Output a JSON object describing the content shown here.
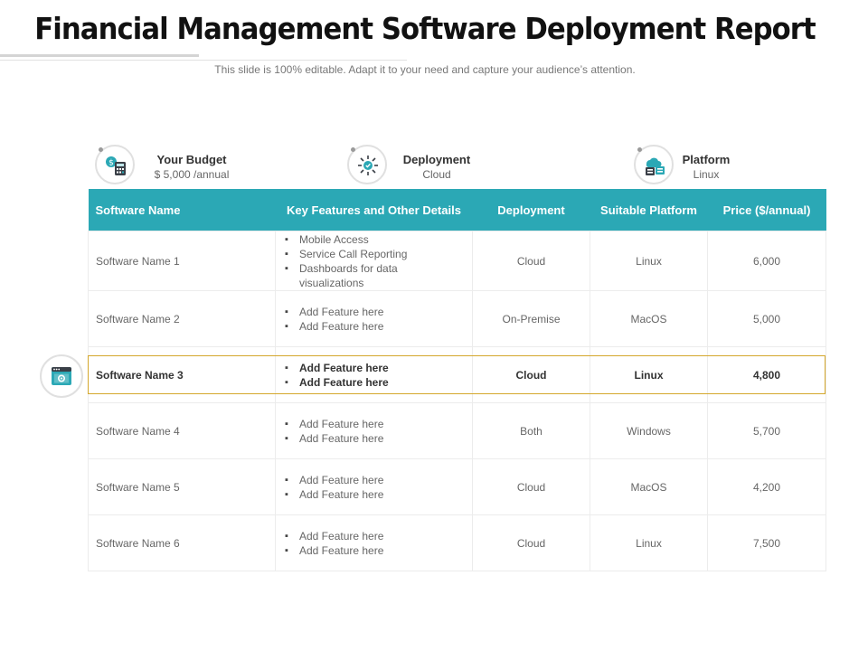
{
  "header": {
    "title": "Financial Management Software Deployment Report",
    "subtitle": "This slide is 100% editable. Adapt it to your need and capture your audience’s attention."
  },
  "info": {
    "budget": {
      "label": "Your Budget",
      "value": "$ 5,000 /annual",
      "icon": "calculator-money-icon"
    },
    "deployment": {
      "label": "Deployment",
      "value": "Cloud",
      "icon": "network-hub-icon"
    },
    "platform": {
      "label": "Platform",
      "value": "Linux",
      "icon": "cloud-server-icon"
    }
  },
  "table": {
    "headers": [
      "Software Name",
      "Key Features and Other Details",
      "Deployment",
      "Suitable Platform",
      "Price ($/annual)"
    ],
    "rows": [
      {
        "name": "Software Name 1",
        "features": [
          "Mobile Access",
          "Service Call Reporting",
          "Dashboards for data visualizations"
        ],
        "deployment": "Cloud",
        "platform": "Linux",
        "price": "6,000"
      },
      {
        "name": "Software Name 2",
        "features": [
          "Add Feature here",
          "Add Feature here"
        ],
        "deployment": "On-Premise",
        "platform": "MacOS",
        "price": "5,000"
      },
      {
        "name": "Software Name 3",
        "features": [
          "Add Feature here",
          "Add Feature here"
        ],
        "deployment": "Cloud",
        "platform": "Linux",
        "price": "4,800"
      },
      {
        "name": "Software Name 4",
        "features": [
          "Add Feature here",
          "Add Feature here"
        ],
        "deployment": "Both",
        "platform": "Windows",
        "price": "5,700"
      },
      {
        "name": "Software Name 5",
        "features": [
          "Add Feature here",
          "Add Feature here"
        ],
        "deployment": "Cloud",
        "platform": "MacOS",
        "price": "4,200"
      },
      {
        "name": "Software Name 6",
        "features": [
          "Add Feature here",
          "Add Feature here"
        ],
        "deployment": "Cloud",
        "platform": "Linux",
        "price": "7,500"
      }
    ]
  },
  "highlight": {
    "row": "Software Name 3",
    "icon": "browser-settings-icon"
  },
  "colors": {
    "accent": "#2ba8b5",
    "highlight_border": "#d4a72c",
    "title": "#111111"
  }
}
